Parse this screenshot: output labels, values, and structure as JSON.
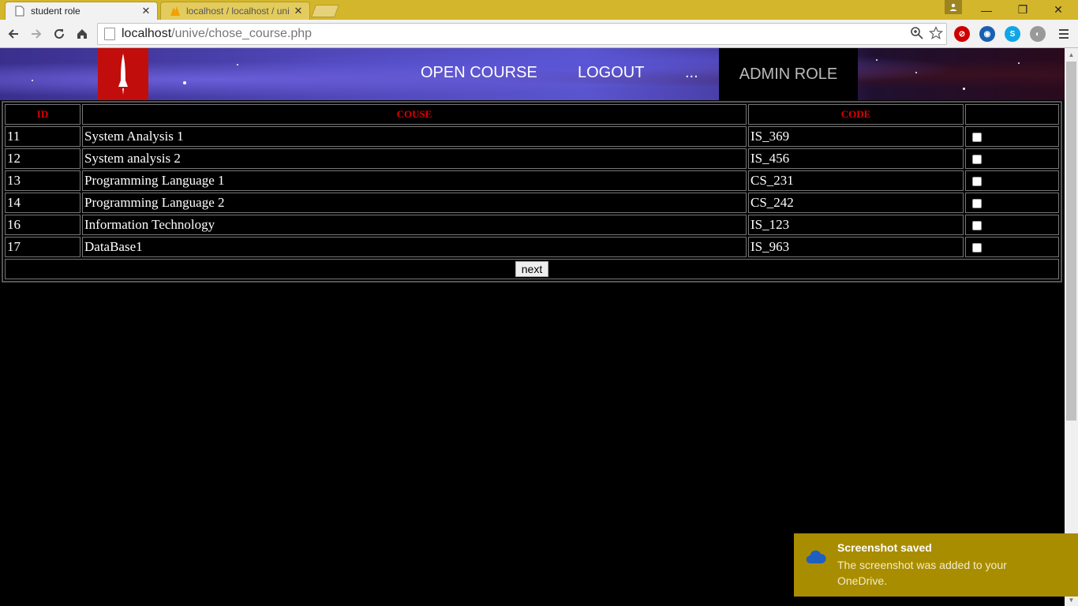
{
  "browser": {
    "tabs": [
      {
        "title": "student role",
        "active": true,
        "close": "✕"
      },
      {
        "title": "localhost / localhost / uni",
        "active": false,
        "close": "✕",
        "favicon_label": "PMA"
      }
    ],
    "address": {
      "host": "localhost",
      "path": "/unive/chose_course.php"
    },
    "window_controls": {
      "minimize": "—",
      "restore": "❐",
      "close": "✕"
    },
    "icons": [
      "back-icon",
      "forward-icon",
      "reload-icon",
      "home-icon",
      "zoom-icon",
      "star-icon",
      "menu-icon"
    ]
  },
  "header": {
    "nav": {
      "open_course": "OPEN COURSE",
      "logout": "LOGOUT",
      "more": "..."
    },
    "role": "ADMIN ROLE"
  },
  "table": {
    "headers": {
      "id": "ID",
      "course": "COUSE",
      "code": "CODE"
    },
    "rows": [
      {
        "id": "11",
        "course": "System Analysis 1",
        "code": "IS_369"
      },
      {
        "id": "12",
        "course": "System analysis 2",
        "code": "IS_456"
      },
      {
        "id": "13",
        "course": "Programming Language 1",
        "code": "CS_231"
      },
      {
        "id": "14",
        "course": "Programming Language 2",
        "code": "CS_242"
      },
      {
        "id": "16",
        "course": "Information Technology",
        "code": "IS_123"
      },
      {
        "id": "17",
        "course": "DataBase1",
        "code": "IS_963"
      }
    ],
    "next_label": "next"
  },
  "notification": {
    "title": "Screenshot saved",
    "body": "The screenshot was added to your OneDrive."
  },
  "colors": {
    "titlebar": "#d4b62c",
    "header_text_red": "#e00000",
    "logo_red": "#c20d0d",
    "toast": "#a98d00"
  }
}
